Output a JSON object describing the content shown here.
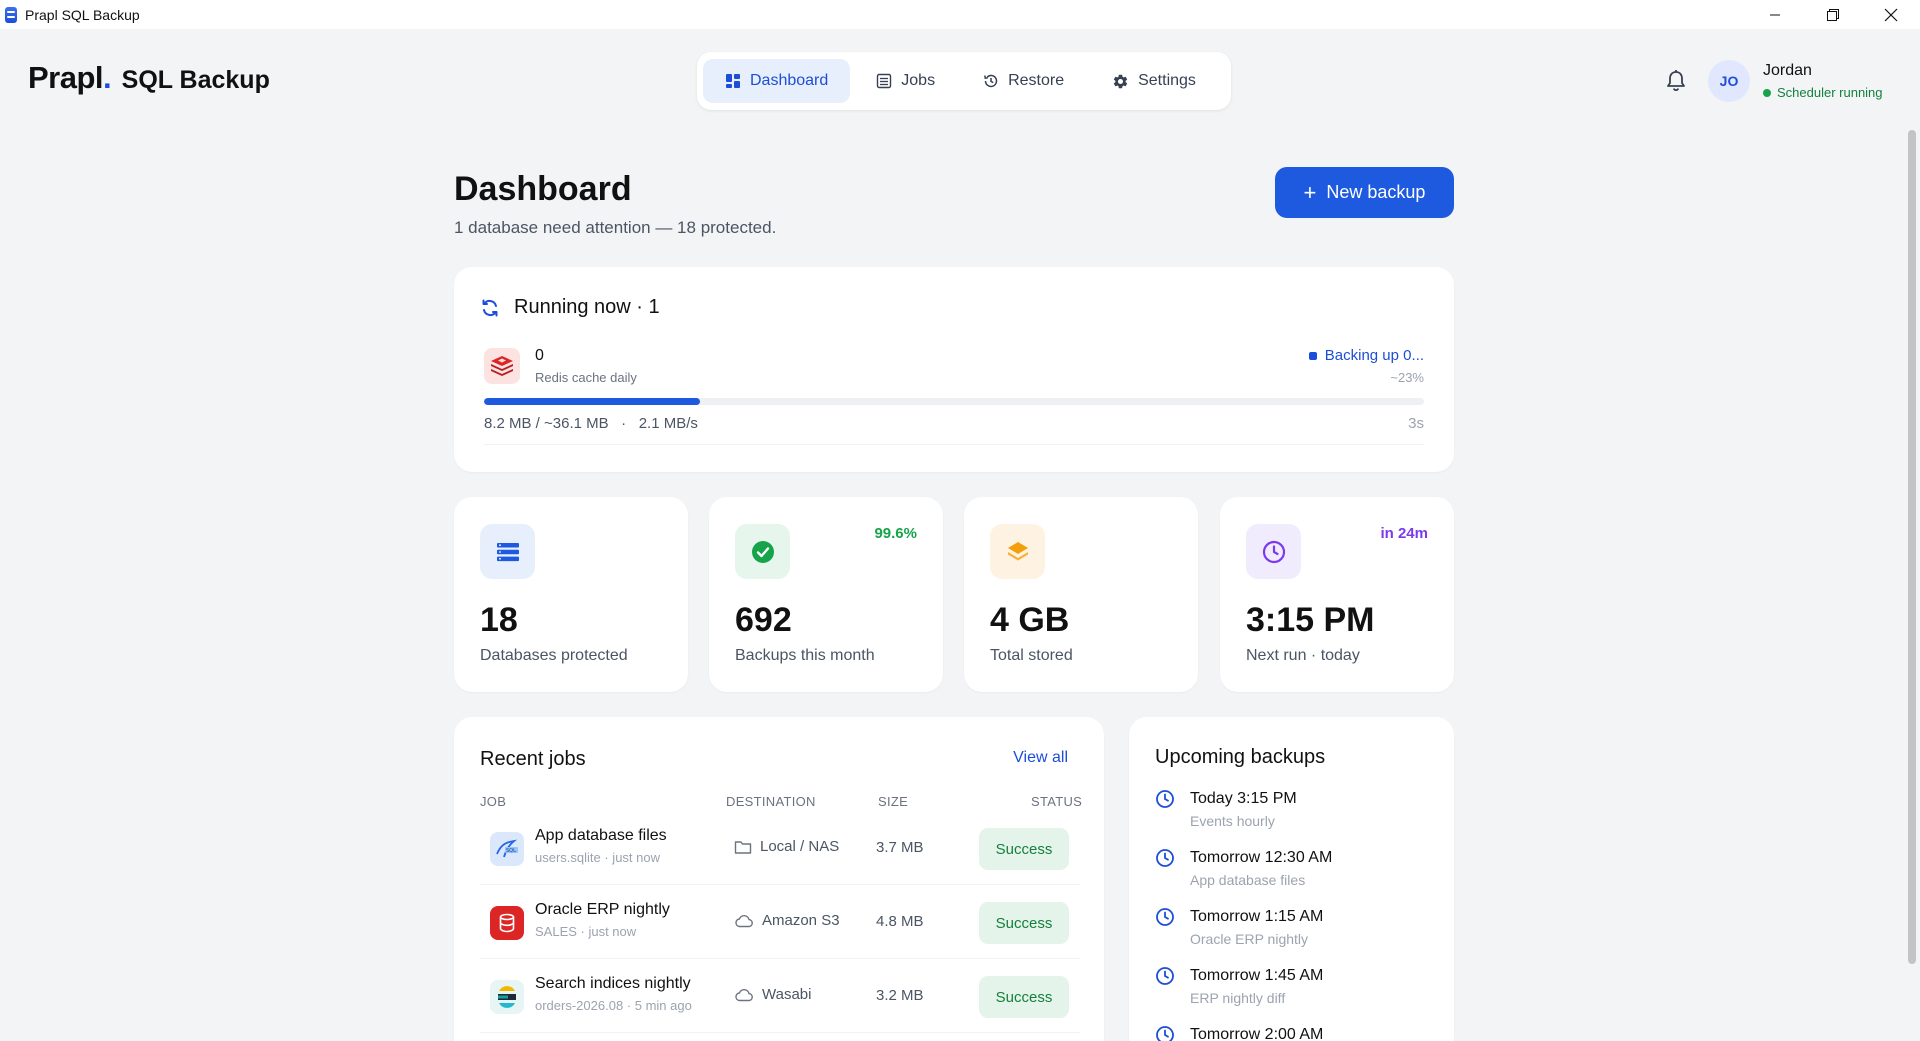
{
  "window": {
    "title": "Prapl SQL Backup"
  },
  "brand": {
    "logo": "Prapl",
    "dot": ".",
    "product": "SQL Backup"
  },
  "nav": {
    "tabs": [
      {
        "label": "Dashboard",
        "icon": "dashboard-icon",
        "active": true
      },
      {
        "label": "Jobs",
        "icon": "list-icon"
      },
      {
        "label": "Restore",
        "icon": "history-icon"
      },
      {
        "label": "Settings",
        "icon": "gear-icon"
      }
    ]
  },
  "user": {
    "initials": "JO",
    "name": "Jordan",
    "status": "Scheduler running",
    "status_color": "#16a34a"
  },
  "page": {
    "title": "Dashboard",
    "subtitle": "1 database need attention — 18 protected.",
    "new_backup_label": "New backup"
  },
  "running": {
    "title": "Running now · 1",
    "job": {
      "name": "0",
      "subtitle": "Redis cache daily",
      "status": "Backing up 0...",
      "percent_label": "~23%",
      "progress": 0.23,
      "transferred": "8.2 MB / ~36.1 MB",
      "separator": "·",
      "speed": "2.1 MB/s",
      "elapsed": "3s"
    }
  },
  "stats": [
    {
      "value": "18",
      "label": "Databases protected",
      "badge": "",
      "icon": "database-icon",
      "accent": "#1d5ae0"
    },
    {
      "value": "692",
      "label": "Backups this month",
      "badge": "99.6%",
      "icon": "check-circle-icon",
      "accent": "#16a34a"
    },
    {
      "value": "4 GB",
      "label": "Total stored",
      "badge": "",
      "icon": "layers-icon",
      "accent": "#f59e0b"
    },
    {
      "value": "3:15 PM",
      "label": "Next run · today",
      "badge": "in 24m",
      "icon": "clock-icon",
      "accent": "#7c3aed"
    }
  ],
  "recent": {
    "title": "Recent jobs",
    "view_all": "View all",
    "columns": [
      "JOB",
      "DESTINATION",
      "SIZE",
      "STATUS"
    ],
    "rows": [
      {
        "name": "App database files",
        "meta": "users.sqlite · just now",
        "destination": "Local / NAS",
        "dest_icon": "folder-icon",
        "size": "3.7 MB",
        "status": "Success",
        "icon": "sqlite-icon"
      },
      {
        "name": "Oracle ERP nightly",
        "meta": "SALES · just now",
        "destination": "Amazon S3",
        "dest_icon": "cloud-icon",
        "size": "4.8 MB",
        "status": "Success",
        "icon": "oracle-icon"
      },
      {
        "name": "Search indices nightly",
        "meta": "orders-2026.08 · 5 min ago",
        "destination": "Wasabi",
        "dest_icon": "cloud-icon",
        "size": "3.2 MB",
        "status": "Success",
        "icon": "elasticsearch-icon"
      }
    ]
  },
  "upcoming": {
    "title": "Upcoming backups",
    "items": [
      {
        "time": "Today 3:15 PM",
        "job": "Events hourly"
      },
      {
        "time": "Tomorrow 12:30 AM",
        "job": "App database files"
      },
      {
        "time": "Tomorrow 1:15 AM",
        "job": "Oracle ERP nightly"
      },
      {
        "time": "Tomorrow 1:45 AM",
        "job": "ERP nightly diff"
      },
      {
        "time": "Tomorrow 2:00 AM",
        "job": ""
      }
    ]
  }
}
